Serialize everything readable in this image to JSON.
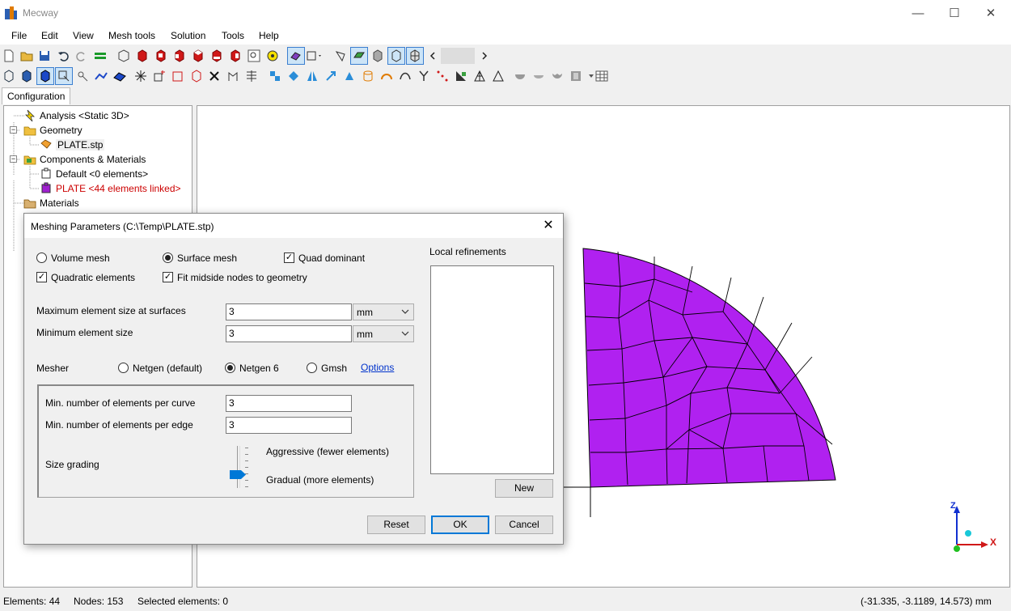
{
  "window": {
    "title": "Mecway",
    "minimize": "—",
    "maximize": "☐",
    "close": "✕"
  },
  "menu": [
    "File",
    "Edit",
    "View",
    "Mesh tools",
    "Solution",
    "Tools",
    "Help"
  ],
  "tab": "Configuration",
  "tree": {
    "analysis": "Analysis <Static 3D>",
    "geometry": "Geometry",
    "geometry_file": "PLATE.stp",
    "components": "Components & Materials",
    "default_component": "Default <0 elements>",
    "plate_component": "PLATE <44 elements linked>",
    "materials": "Materials",
    "plate_color": "#cc0000"
  },
  "dialog": {
    "title": "Meshing Parameters (C:\\Temp\\PLATE.stp)",
    "volume_mesh": "Volume mesh",
    "surface_mesh": "Surface mesh",
    "quad_dominant": "Quad dominant",
    "quadratic_elements": "Quadratic elements",
    "fit_midside": "Fit midside nodes to geometry",
    "max_size_label": "Maximum element size at surfaces",
    "max_size_value": "3",
    "max_size_unit": "mm",
    "min_size_label": "Minimum element size",
    "min_size_value": "3",
    "min_size_unit": "mm",
    "mesher_label": "Mesher",
    "mesher_netgen": "Netgen (default)",
    "mesher_netgen6": "Netgen 6",
    "mesher_gmsh": "Gmsh",
    "options_link": "Options",
    "min_per_curve_label": "Min. number of elements per curve",
    "min_per_curve_value": "3",
    "min_per_edge_label": "Min. number of elements per edge",
    "min_per_edge_value": "3",
    "size_grading_label": "Size grading",
    "aggressive_label": "Aggressive (fewer elements)",
    "gradual_label": "Gradual (more elements)",
    "local_refinements_label": "Local refinements",
    "new_button": "New",
    "reset_button": "Reset",
    "ok_button": "OK",
    "cancel_button": "Cancel"
  },
  "triad": {
    "z": "Z",
    "x": "X"
  },
  "mesh_color": "#b021f0",
  "status": {
    "elements": "Elements: 44",
    "nodes": "Nodes: 153",
    "selected": "Selected elements: 0",
    "coords": "(-31.335, -3.1189, 14.573) mm"
  }
}
